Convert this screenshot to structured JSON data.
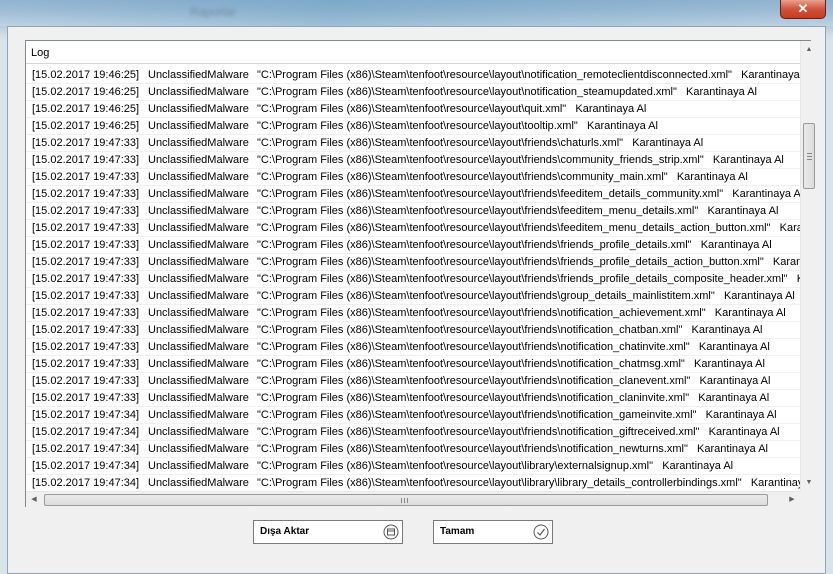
{
  "window": {
    "title": "Raporlar",
    "close_label": "✕"
  },
  "log": {
    "header": "Log",
    "rows": [
      {
        "date": "[15.02.2017 19:46:25]",
        "type": "UnclassifiedMalware",
        "text": "\"C:\\Program Files (x86)\\Steam\\tenfoot\\resource\\layout\\notification_remoteclientdisconnected.xml\"   Karantinaya Al"
      },
      {
        "date": "[15.02.2017 19:46:25]",
        "type": "UnclassifiedMalware",
        "text": "\"C:\\Program Files (x86)\\Steam\\tenfoot\\resource\\layout\\notification_steamupdated.xml\"   Karantinaya Al"
      },
      {
        "date": "[15.02.2017 19:46:25]",
        "type": "UnclassifiedMalware",
        "text": "\"C:\\Program Files (x86)\\Steam\\tenfoot\\resource\\layout\\quit.xml\"   Karantinaya Al"
      },
      {
        "date": "[15.02.2017 19:46:25]",
        "type": "UnclassifiedMalware",
        "text": "\"C:\\Program Files (x86)\\Steam\\tenfoot\\resource\\layout\\tooltip.xml\"   Karantinaya Al"
      },
      {
        "date": "[15.02.2017 19:47:33]",
        "type": "UnclassifiedMalware",
        "text": "\"C:\\Program Files (x86)\\Steam\\tenfoot\\resource\\layout\\friends\\chaturls.xml\"   Karantinaya Al"
      },
      {
        "date": "[15.02.2017 19:47:33]",
        "type": "UnclassifiedMalware",
        "text": "\"C:\\Program Files (x86)\\Steam\\tenfoot\\resource\\layout\\friends\\community_friends_strip.xml\"   Karantinaya Al"
      },
      {
        "date": "[15.02.2017 19:47:33]",
        "type": "UnclassifiedMalware",
        "text": "\"C:\\Program Files (x86)\\Steam\\tenfoot\\resource\\layout\\friends\\community_main.xml\"   Karantinaya Al"
      },
      {
        "date": "[15.02.2017 19:47:33]",
        "type": "UnclassifiedMalware",
        "text": "\"C:\\Program Files (x86)\\Steam\\tenfoot\\resource\\layout\\friends\\feeditem_details_community.xml\"   Karantinaya Al"
      },
      {
        "date": "[15.02.2017 19:47:33]",
        "type": "UnclassifiedMalware",
        "text": "\"C:\\Program Files (x86)\\Steam\\tenfoot\\resource\\layout\\friends\\feeditem_menu_details.xml\"   Karantinaya Al"
      },
      {
        "date": "[15.02.2017 19:47:33]",
        "type": "UnclassifiedMalware",
        "text": "\"C:\\Program Files (x86)\\Steam\\tenfoot\\resource\\layout\\friends\\feeditem_menu_details_action_button.xml\"   Karantinaya Al"
      },
      {
        "date": "[15.02.2017 19:47:33]",
        "type": "UnclassifiedMalware",
        "text": "\"C:\\Program Files (x86)\\Steam\\tenfoot\\resource\\layout\\friends\\friends_profile_details.xml\"   Karantinaya Al"
      },
      {
        "date": "[15.02.2017 19:47:33]",
        "type": "UnclassifiedMalware",
        "text": "\"C:\\Program Files (x86)\\Steam\\tenfoot\\resource\\layout\\friends\\friends_profile_details_action_button.xml\"   Karantinaya Al"
      },
      {
        "date": "[15.02.2017 19:47:33]",
        "type": "UnclassifiedMalware",
        "text": "\"C:\\Program Files (x86)\\Steam\\tenfoot\\resource\\layout\\friends\\friends_profile_details_composite_header.xml\"   Karantinaya Al"
      },
      {
        "date": "[15.02.2017 19:47:33]",
        "type": "UnclassifiedMalware",
        "text": "\"C:\\Program Files (x86)\\Steam\\tenfoot\\resource\\layout\\friends\\group_details_mainlistitem.xml\"   Karantinaya Al"
      },
      {
        "date": "[15.02.2017 19:47:33]",
        "type": "UnclassifiedMalware",
        "text": "\"C:\\Program Files (x86)\\Steam\\tenfoot\\resource\\layout\\friends\\notification_achievement.xml\"   Karantinaya Al"
      },
      {
        "date": "[15.02.2017 19:47:33]",
        "type": "UnclassifiedMalware",
        "text": "\"C:\\Program Files (x86)\\Steam\\tenfoot\\resource\\layout\\friends\\notification_chatban.xml\"   Karantinaya Al"
      },
      {
        "date": "[15.02.2017 19:47:33]",
        "type": "UnclassifiedMalware",
        "text": "\"C:\\Program Files (x86)\\Steam\\tenfoot\\resource\\layout\\friends\\notification_chatinvite.xml\"   Karantinaya Al"
      },
      {
        "date": "[15.02.2017 19:47:33]",
        "type": "UnclassifiedMalware",
        "text": "\"C:\\Program Files (x86)\\Steam\\tenfoot\\resource\\layout\\friends\\notification_chatmsg.xml\"   Karantinaya Al"
      },
      {
        "date": "[15.02.2017 19:47:33]",
        "type": "UnclassifiedMalware",
        "text": "\"C:\\Program Files (x86)\\Steam\\tenfoot\\resource\\layout\\friends\\notification_clanevent.xml\"   Karantinaya Al"
      },
      {
        "date": "[15.02.2017 19:47:33]",
        "type": "UnclassifiedMalware",
        "text": "\"C:\\Program Files (x86)\\Steam\\tenfoot\\resource\\layout\\friends\\notification_claninvite.xml\"   Karantinaya Al"
      },
      {
        "date": "[15.02.2017 19:47:34]",
        "type": "UnclassifiedMalware",
        "text": "\"C:\\Program Files (x86)\\Steam\\tenfoot\\resource\\layout\\friends\\notification_gameinvite.xml\"   Karantinaya Al"
      },
      {
        "date": "[15.02.2017 19:47:34]",
        "type": "UnclassifiedMalware",
        "text": "\"C:\\Program Files (x86)\\Steam\\tenfoot\\resource\\layout\\friends\\notification_giftreceived.xml\"   Karantinaya Al"
      },
      {
        "date": "[15.02.2017 19:47:34]",
        "type": "UnclassifiedMalware",
        "text": "\"C:\\Program Files (x86)\\Steam\\tenfoot\\resource\\layout\\friends\\notification_newturns.xml\"   Karantinaya Al"
      },
      {
        "date": "[15.02.2017 19:47:34]",
        "type": "UnclassifiedMalware",
        "text": "\"C:\\Program Files (x86)\\Steam\\tenfoot\\resource\\layout\\library\\externalsignup.xml\"   Karantinaya Al"
      },
      {
        "date": "[15.02.2017 19:47:34]",
        "type": "UnclassifiedMalware",
        "text": "\"C:\\Program Files (x86)\\Steam\\tenfoot\\resource\\layout\\library\\library_details_controllerbindings.xml\"   Karantinaya Al"
      }
    ]
  },
  "buttons": {
    "export_label": "Dışa Aktar",
    "ok_label": "Tamam"
  },
  "icons": {
    "export": "export-icon",
    "ok": "checkmark-circle-icon",
    "close": "close-icon"
  },
  "colors": {
    "close_button": "#c53b20",
    "window_frame": "#8db1cf"
  }
}
